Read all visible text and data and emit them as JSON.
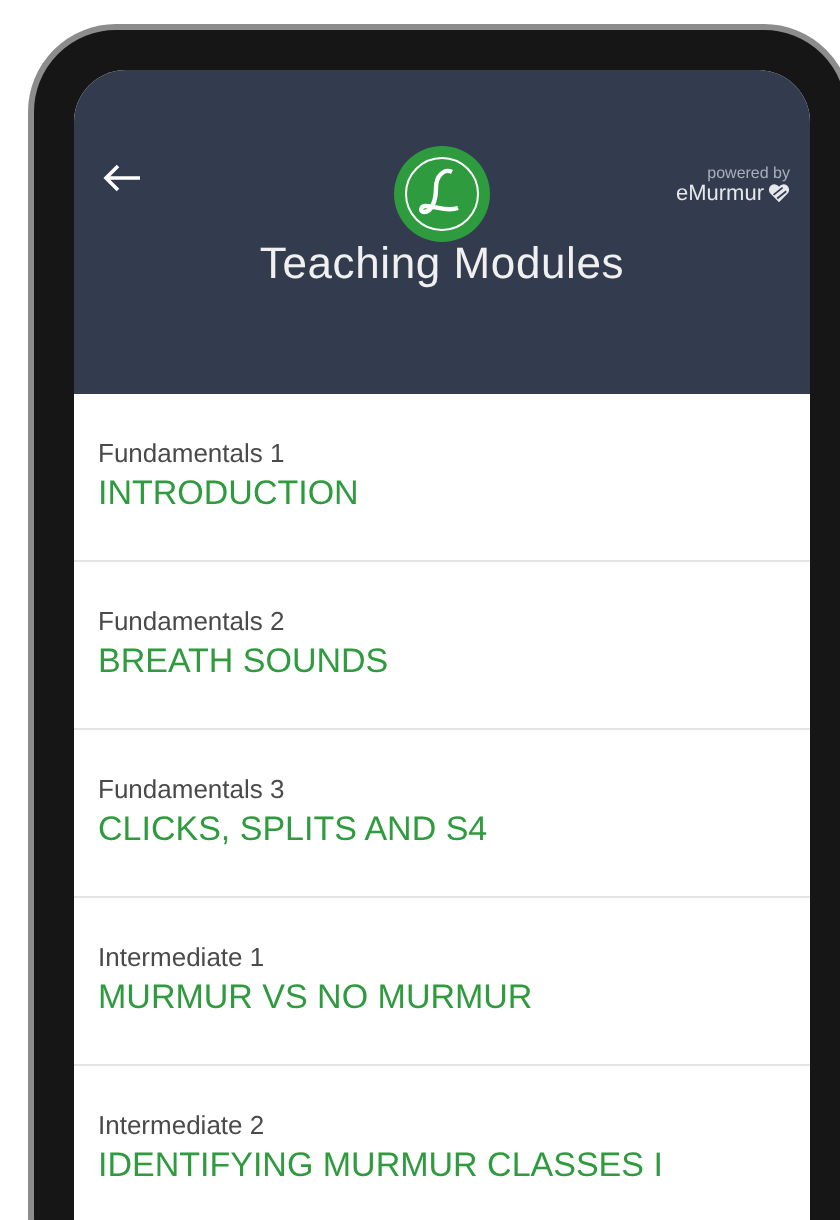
{
  "header": {
    "title": "Teaching Modules",
    "powered_by": "powered by",
    "brand": "eMurmur"
  },
  "modules": [
    {
      "category": "Fundamentals 1",
      "title": "INTRODUCTION"
    },
    {
      "category": "Fundamentals 2",
      "title": "BREATH SOUNDS"
    },
    {
      "category": "Fundamentals 3",
      "title": "CLICKS, SPLITS AND S4"
    },
    {
      "category": "Intermediate 1",
      "title": "MURMUR VS NO MURMUR"
    },
    {
      "category": "Intermediate 2",
      "title": "IDENTIFYING MURMUR CLASSES I"
    }
  ]
}
